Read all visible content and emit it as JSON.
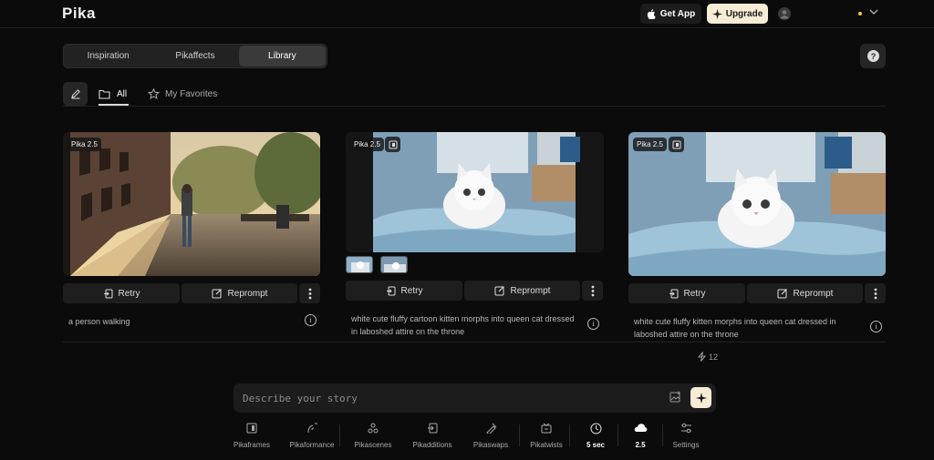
{
  "app": {
    "logo": "Pika"
  },
  "header": {
    "get_app_label": "Get App",
    "upgrade_label": "Upgrade"
  },
  "nav": {
    "tabs": [
      {
        "label": "Inspiration",
        "active": false
      },
      {
        "label": "Pikaffects",
        "active": false
      },
      {
        "label": "Library",
        "active": true
      }
    ],
    "help_label": "?"
  },
  "filters": {
    "all_label": "All",
    "favorites_label": "My Favorites"
  },
  "cards": [
    {
      "model": "Pika 2.5",
      "retry_label": "Retry",
      "reprompt_label": "Reprompt",
      "prompt": "a person walking"
    },
    {
      "model": "Pika 2.5",
      "retry_label": "Retry",
      "reprompt_label": "Reprompt",
      "prompt": "white cute fluffy cartoon kitten morphs into queen cat dressed in laboshed attire on the throne"
    },
    {
      "model": "Pika 2.5",
      "retry_label": "Retry",
      "reprompt_label": "Reprompt",
      "prompt": "white cute fluffy kitten morphs into queen cat dressed in laboshed attire on the throne"
    }
  ],
  "credits": {
    "count": "12"
  },
  "prompt_bar": {
    "placeholder": "Describe your story"
  },
  "toolbar": {
    "items": [
      {
        "label": "Pikaframes",
        "icon": "frames-icon"
      },
      {
        "label": "Pikaformance",
        "icon": "performance-icon"
      },
      {
        "label": "Pikascenes",
        "icon": "scenes-icon"
      },
      {
        "label": "Pikadditions",
        "icon": "additions-icon"
      },
      {
        "label": "Pikaswaps",
        "icon": "swaps-icon"
      },
      {
        "label": "Pikatwists",
        "icon": "twists-icon"
      },
      {
        "label": "5 sec",
        "icon": "clock-icon"
      },
      {
        "label": "2.5",
        "icon": "cloud-icon"
      },
      {
        "label": "Settings",
        "icon": "sliders-icon"
      }
    ]
  },
  "colors": {
    "accent": "#f7ecd6",
    "background": "#0b0b0b",
    "status_dot": "#f2c44d"
  }
}
